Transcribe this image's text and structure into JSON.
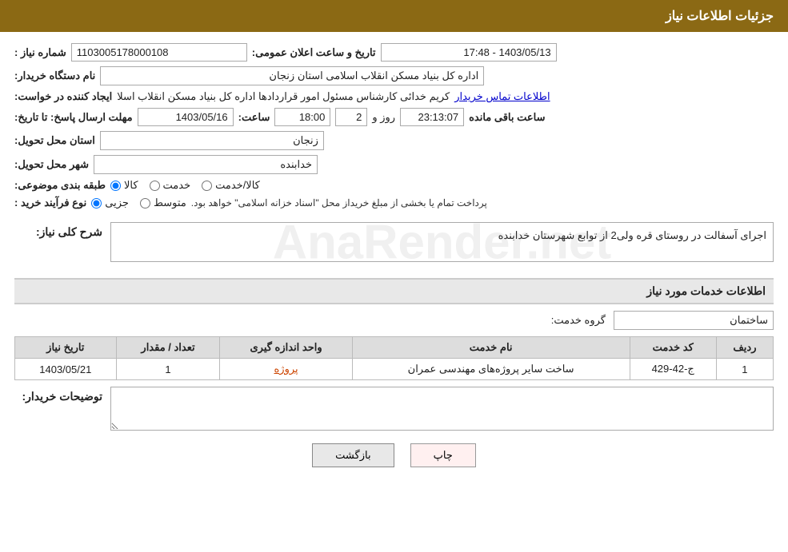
{
  "header": {
    "title": "جزئیات اطلاعات نیاز"
  },
  "fields": {
    "shomara_niaz_label": "شماره نیاز :",
    "shomara_niaz_value": "1103005178000108",
    "tarikh_label": "تاریخ و ساعت اعلان عمومی:",
    "tarikh_value": "1403/05/13 - 17:48",
    "nam_dastgah_label": "نام دستگاه خریدار:",
    "nam_dastgah_value": "اداره کل بنیاد مسکن انقلاب اسلامی استان زنجان",
    "ijad_label": "ایجاد کننده در خواست:",
    "ijad_value": "کریم خدائی کارشناس مسئول امور قراردادها اداره کل بنیاد مسکن انقلاب اسلا",
    "ijad_link": "اطلاعات تماس خریدار",
    "mohlat_label": "مهلت ارسال پاسخ: تا تاریخ:",
    "mohlat_date": "1403/05/16",
    "mohlat_saat_label": "ساعت:",
    "mohlat_saat": "18:00",
    "mohlat_roz_label": "روز و",
    "mohlat_roz": "2",
    "mohlat_remaining": "23:13:07",
    "mohlat_remaining_label": "ساعت باقی مانده",
    "ostan_label": "استان محل تحویل:",
    "ostan_value": "زنجان",
    "shahr_label": "شهر محل تحویل:",
    "shahr_value": "خدابنده",
    "tabaqe_label": "طبقه بندی موضوعی:",
    "tabaqe_kala": "کالا",
    "tabaqe_khadamat": "خدمت",
    "tabaqe_kala_khadamat": "کالا/خدمت",
    "nooe_farayand_label": "نوع فرآیند خرید :",
    "nooe_jozii": "جزیی",
    "nooe_motavaset": "متوسط",
    "nooe_note": "پرداخت تمام یا بخشی از مبلغ خریداز محل \"اسناد خزانه اسلامی\" خواهد بود.",
    "sharh_label": "شرح کلی نیاز:",
    "sharh_value": "اجرای آسفالت در روستای   قره ولی2 از توابع شهرستان خدابنده",
    "khadamat_title": "اطلاعات خدمات مورد نیاز",
    "gorooh_label": "گروه خدمت:",
    "gorooh_value": "ساختمان",
    "table": {
      "headers": [
        "ردیف",
        "کد خدمت",
        "نام خدمت",
        "واحد اندازه گیری",
        "تعداد / مقدار",
        "تاریخ نیاز"
      ],
      "rows": [
        {
          "radif": "1",
          "kod": "ج-42-429",
          "nam": "ساخت سایر پروژه‌های مهندسی عمران",
          "vahed": "پروژه",
          "tedad": "1",
          "tarikh": "1403/05/21"
        }
      ]
    },
    "توضیحات_label": "توضیحات خریدار:",
    "توضیحات_value": ""
  },
  "buttons": {
    "print": "چاپ",
    "back": "بازگشت"
  }
}
